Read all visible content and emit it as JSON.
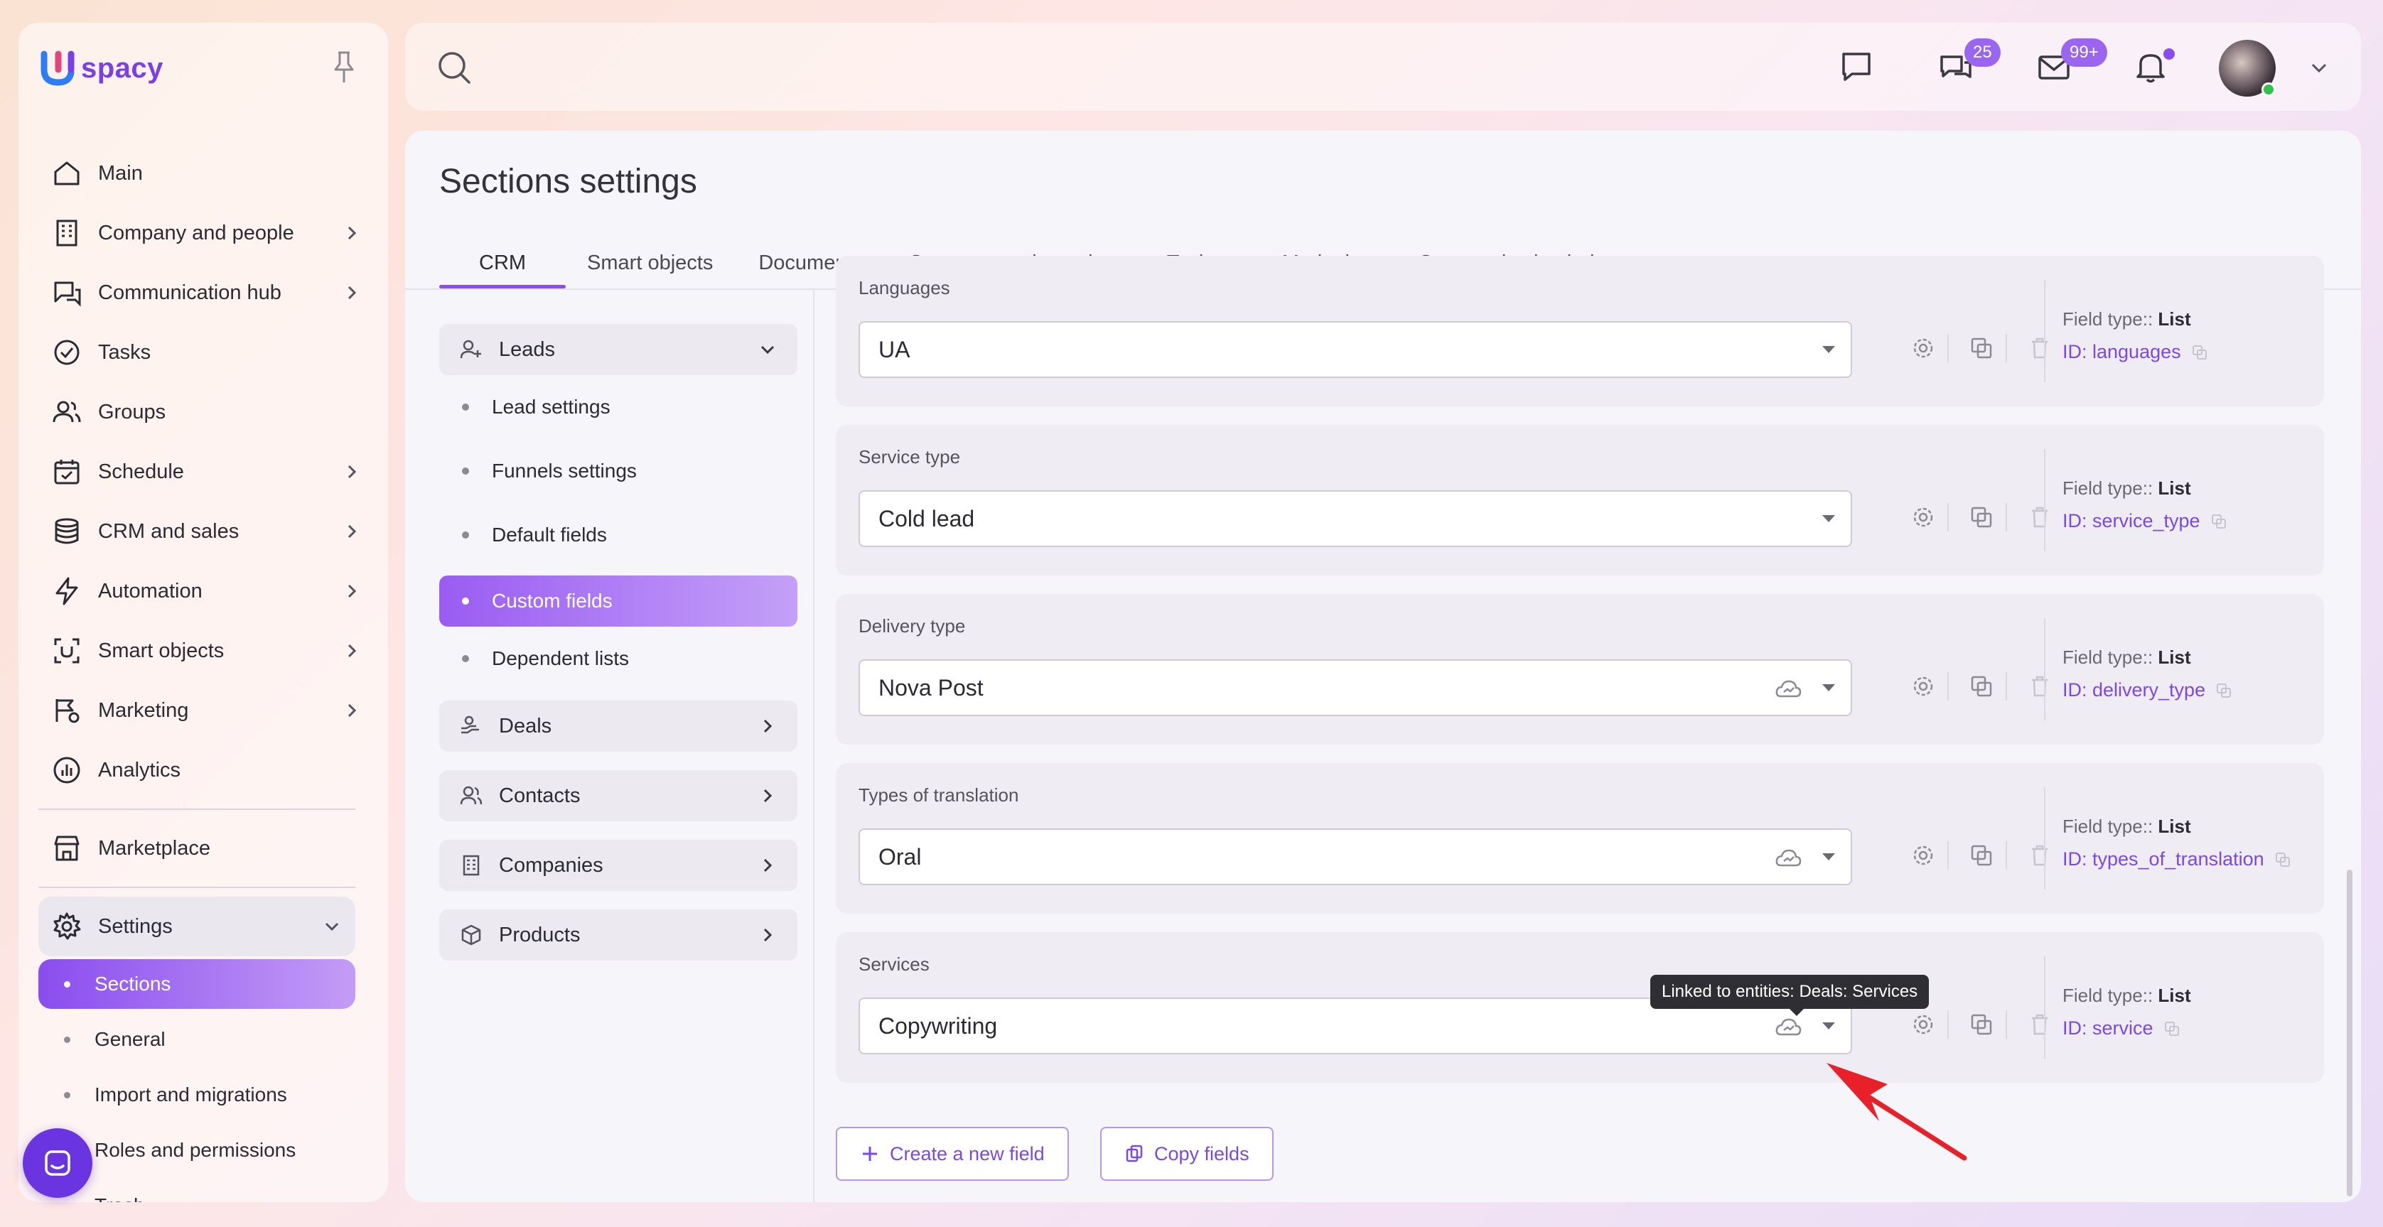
{
  "app": {
    "logo_text": "spacy",
    "brand_color": "#7b3fe4"
  },
  "sidebar": {
    "items": [
      {
        "label": "Main",
        "icon": "home-icon",
        "has_chevron": false
      },
      {
        "label": "Company and people",
        "icon": "building-icon",
        "has_chevron": true
      },
      {
        "label": "Communication hub",
        "icon": "communication-icon",
        "has_chevron": true
      },
      {
        "label": "Tasks",
        "icon": "check-circle-icon",
        "has_chevron": false
      },
      {
        "label": "Groups",
        "icon": "users-icon",
        "has_chevron": false
      },
      {
        "label": "Schedule",
        "icon": "calendar-icon",
        "has_chevron": true
      },
      {
        "label": "CRM and sales",
        "icon": "database-icon",
        "has_chevron": true
      },
      {
        "label": "Automation",
        "icon": "lightning-icon",
        "has_chevron": true
      },
      {
        "label": "Smart objects",
        "icon": "smart-objects-icon",
        "has_chevron": true
      },
      {
        "label": "Marketing",
        "icon": "marketing-icon",
        "has_chevron": true
      },
      {
        "label": "Analytics",
        "icon": "analytics-icon",
        "has_chevron": false
      },
      {
        "label": "Marketplace",
        "icon": "store-icon",
        "has_chevron": false
      },
      {
        "label": "Settings",
        "icon": "gear-icon",
        "has_chevron": true
      }
    ],
    "settings_sub": [
      {
        "label": "Sections",
        "active": true
      },
      {
        "label": "General",
        "active": false
      },
      {
        "label": "Import and migrations",
        "active": false
      },
      {
        "label": "Roles and permissions",
        "active": false
      },
      {
        "label": "Trash",
        "active": false
      }
    ]
  },
  "topbar": {
    "chat_badge": "25",
    "mail_badge": "99+"
  },
  "page": {
    "title": "Sections settings",
    "tabs": [
      "CRM",
      "Smart objects",
      "Documents",
      "Company and people",
      "Tasks",
      "Marketing",
      "Communication hub"
    ],
    "active_tab": "CRM"
  },
  "left_menu": {
    "leads": {
      "label": "Leads",
      "items": [
        "Lead settings",
        "Funnels settings",
        "Default fields",
        "Custom fields",
        "Dependent lists"
      ],
      "active": "Custom fields"
    },
    "groups": [
      "Deals",
      "Contacts",
      "Companies",
      "Products"
    ]
  },
  "fields": [
    {
      "label": "Languages",
      "value": "UA",
      "linked": false,
      "type_label": "Field type::",
      "type": "List",
      "id": "ID: languages"
    },
    {
      "label": "Service type",
      "value": "Cold lead",
      "linked": false,
      "type_label": "Field type::",
      "type": "List",
      "id": "ID: service_type"
    },
    {
      "label": "Delivery type",
      "value": "Nova Post",
      "linked": true,
      "type_label": "Field type::",
      "type": "List",
      "id": "ID: delivery_type"
    },
    {
      "label": "Types of translation",
      "value": "Oral",
      "linked": true,
      "type_label": "Field type::",
      "type": "List",
      "id": "ID: types_of_translation"
    },
    {
      "label": "Services",
      "value": "Copywriting",
      "linked": true,
      "type_label": "Field type::",
      "type": "List",
      "id": "ID: service"
    }
  ],
  "tooltip": "Linked to entities: Deals: Services",
  "buttons": {
    "create": "Create a new field",
    "copy": "Copy fields"
  }
}
